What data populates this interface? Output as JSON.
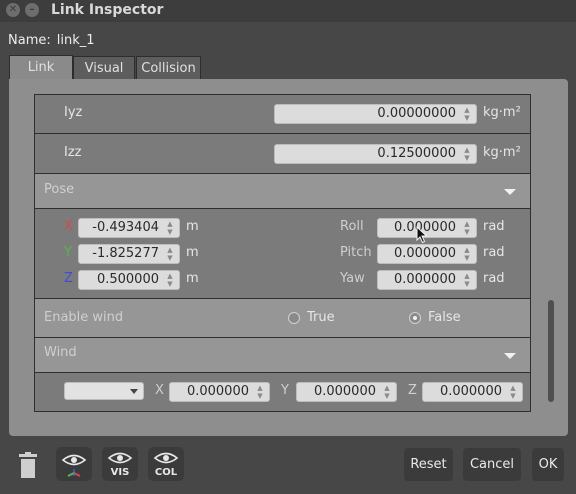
{
  "window": {
    "title": "Link Inspector"
  },
  "name_row": {
    "label": "Name:",
    "value": "link_1"
  },
  "tabs": [
    {
      "label": "Link"
    },
    {
      "label": "Visual"
    },
    {
      "label": "Collision"
    }
  ],
  "inertia": {
    "iyz": {
      "label": "Iyz",
      "value": "0.00000000",
      "unit": "kg·m²"
    },
    "izz": {
      "label": "Izz",
      "value": "0.12500000",
      "unit": "kg·m²"
    }
  },
  "pose": {
    "header": "Pose",
    "x": {
      "label": "X",
      "value": "-0.493404",
      "unit": "m",
      "color": "#d24a4a"
    },
    "y": {
      "label": "Y",
      "value": "-1.825277",
      "unit": "m",
      "color": "#4fb84f"
    },
    "z": {
      "label": "Z",
      "value": "0.500000",
      "unit": "m",
      "color": "#3b4fd6"
    },
    "roll": {
      "label": "Roll",
      "value": "0.000000",
      "unit": "rad"
    },
    "pitch": {
      "label": "Pitch",
      "value": "0.000000",
      "unit": "rad"
    },
    "yaw": {
      "label": "Yaw",
      "value": "0.000000",
      "unit": "rad"
    }
  },
  "enable_wind": {
    "label": "Enable wind",
    "option_true": "True",
    "option_false": "False",
    "selected": "False"
  },
  "wind": {
    "header": "Wind",
    "x": {
      "label": "X",
      "value": "0.000000"
    },
    "y": {
      "label": "Y",
      "value": "0.000000"
    },
    "z": {
      "label": "Z",
      "value": "0.000000"
    }
  },
  "toolbar": {
    "vis_label": "VIS",
    "col_label": "COL",
    "reset_label": "Reset",
    "cancel_label": "Cancel",
    "ok_label": "OK"
  }
}
